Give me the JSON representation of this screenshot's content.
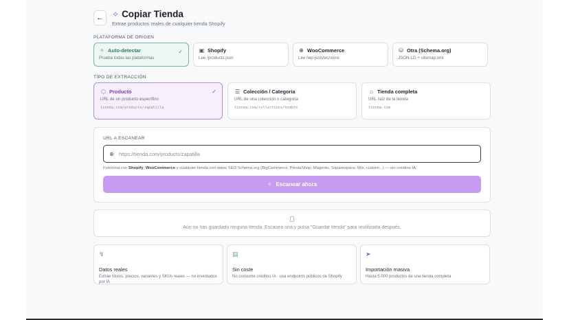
{
  "header": {
    "back_icon": "arrow-left-icon",
    "title": "Copiar Tienda",
    "title_icon": "sparkles-icon",
    "subtitle": "Extrae productos reales de cualquier tienda Shopify"
  },
  "platform": {
    "label": "PLATAFORMA DE ORIGEN",
    "options": [
      {
        "title": "Auto-detectar",
        "desc": "Prueba todas las plataformas",
        "icon": "sparkles-icon",
        "selected": true
      },
      {
        "title": "Shopify",
        "desc": "Lee /products.json",
        "icon": "bag-icon",
        "selected": false
      },
      {
        "title": "WooCommerce",
        "desc": "Lee /wp-json/wc/store",
        "icon": "globe-icon",
        "selected": false
      },
      {
        "title": "Otra (Schema.org)",
        "desc": "JSON-LD + sitemap.xml",
        "icon": "database-icon",
        "selected": false
      }
    ]
  },
  "extraction": {
    "label": "TIPO DE EXTRACCIÓN",
    "options": [
      {
        "title": "Producto",
        "desc": "URL de un producto específico",
        "example": "tienda.com/products/zapatilla",
        "icon": "box-icon",
        "selected": true
      },
      {
        "title": "Colección / Categoría",
        "desc": "URL de una colección o categoría",
        "example": "tienda.com/collections/hombre",
        "icon": "layers-icon",
        "selected": false
      },
      {
        "title": "Tienda completa",
        "desc": "URL raíz de la tienda",
        "example": "tienda.com",
        "icon": "store-icon",
        "selected": false
      }
    ]
  },
  "url": {
    "label": "URL A ESCANEAR",
    "placeholder": "https://tienda.com/products/zapatilla",
    "value": "",
    "note_prefix": "Funciona con ",
    "note_shopify": "Shopify",
    "note_sep": ", ",
    "note_woo": "WooCommerce",
    "note_suffix": " y cualquier tienda con datos SEO Schema.org (BigCommerce, PrestaShop, Magento, Squarespace, Wix, custom...) — sin créditos IA.",
    "scan_label": "Escanear ahora"
  },
  "saved": {
    "empty_text": "Aún no has guardado ninguna tienda. Escanea una y pulsa \"Guardar tienda\" para reutilizarla después."
  },
  "features": [
    {
      "icon": "bolt-icon",
      "title": "Datos reales",
      "desc": "Extrae títulos, precios, variantes y SKUs reales — no inventados por IA"
    },
    {
      "icon": "coin-icon",
      "title": "Sin coste",
      "desc": "No consume créditos IA · usa endpoints públicos de Shopify"
    },
    {
      "icon": "rocket-icon",
      "title": "Importación masiva",
      "desc": "Hasta 5.000 productos de una tienda completa"
    }
  ],
  "colors": {
    "accent_green": "#6fb8a1",
    "accent_purple": "#b387e6",
    "scan_button": "#c79bf2"
  }
}
